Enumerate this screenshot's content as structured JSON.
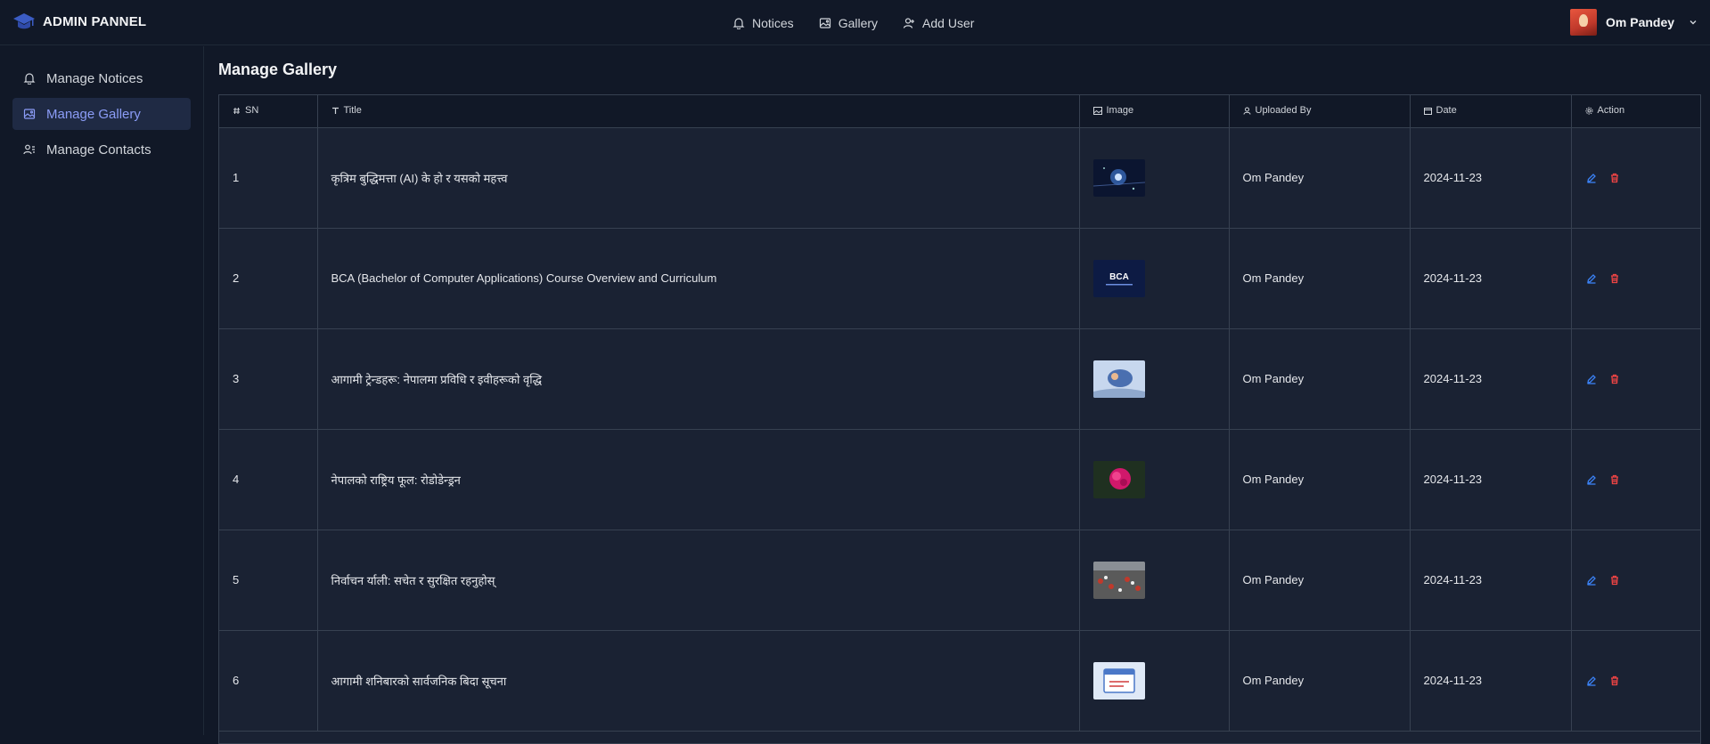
{
  "brand": {
    "name": "ADMIN PANNEL",
    "icon": "graduation-cap-icon"
  },
  "topnav": [
    {
      "label": "Notices",
      "icon": "bell-icon"
    },
    {
      "label": "Gallery",
      "icon": "gallery-icon"
    },
    {
      "label": "Add User",
      "icon": "add-user-icon"
    }
  ],
  "user": {
    "name": "Om Pandey"
  },
  "sidebar": {
    "items": [
      {
        "label": "Manage Notices",
        "icon": "bell-icon",
        "active": false
      },
      {
        "label": "Manage Gallery",
        "icon": "gallery-icon",
        "active": true
      },
      {
        "label": "Manage Contacts",
        "icon": "contacts-icon",
        "active": false
      }
    ]
  },
  "page": {
    "title": "Manage Gallery"
  },
  "table": {
    "columns": [
      "SN",
      "Title",
      "Image",
      "Uploaded By",
      "Date",
      "Action"
    ],
    "rows": [
      {
        "sn": "1",
        "title": "कृत्रिम बुद्धिमत्ता (AI) के हो र यसको महत्त्व",
        "uploaded_by": "Om Pandey",
        "date": "2024-11-23",
        "thumb": "ai"
      },
      {
        "sn": "2",
        "title": "BCA (Bachelor of Computer Applications) Course Overview and Curriculum",
        "uploaded_by": "Om Pandey",
        "date": "2024-11-23",
        "thumb": "bca",
        "thumb_text": "BCA"
      },
      {
        "sn": "3",
        "title": "आगामी ट्रेन्डहरू: नेपालमा प्रविधि र इवीहरूको वृद्धि",
        "uploaded_by": "Om Pandey",
        "date": "2024-11-23",
        "thumb": "tech"
      },
      {
        "sn": "4",
        "title": "नेपालको राष्ट्रिय फूल: रोडोडेन्ड्रन",
        "uploaded_by": "Om Pandey",
        "date": "2024-11-23",
        "thumb": "flower"
      },
      {
        "sn": "5",
        "title": "निर्वाचन र्याली: सचेत र सुरक्षित रहनुहोस्",
        "uploaded_by": "Om Pandey",
        "date": "2024-11-23",
        "thumb": "rally"
      },
      {
        "sn": "6",
        "title": "आगामी शनिबारको सार्वजनिक बिदा सूचना",
        "uploaded_by": "Om Pandey",
        "date": "2024-11-23",
        "thumb": "holiday"
      }
    ]
  },
  "colors": {
    "accent": "#8b9cf6",
    "edit": "#3b82f6",
    "delete": "#ef4444",
    "bg": "#111827",
    "cell": "#1a2233"
  }
}
